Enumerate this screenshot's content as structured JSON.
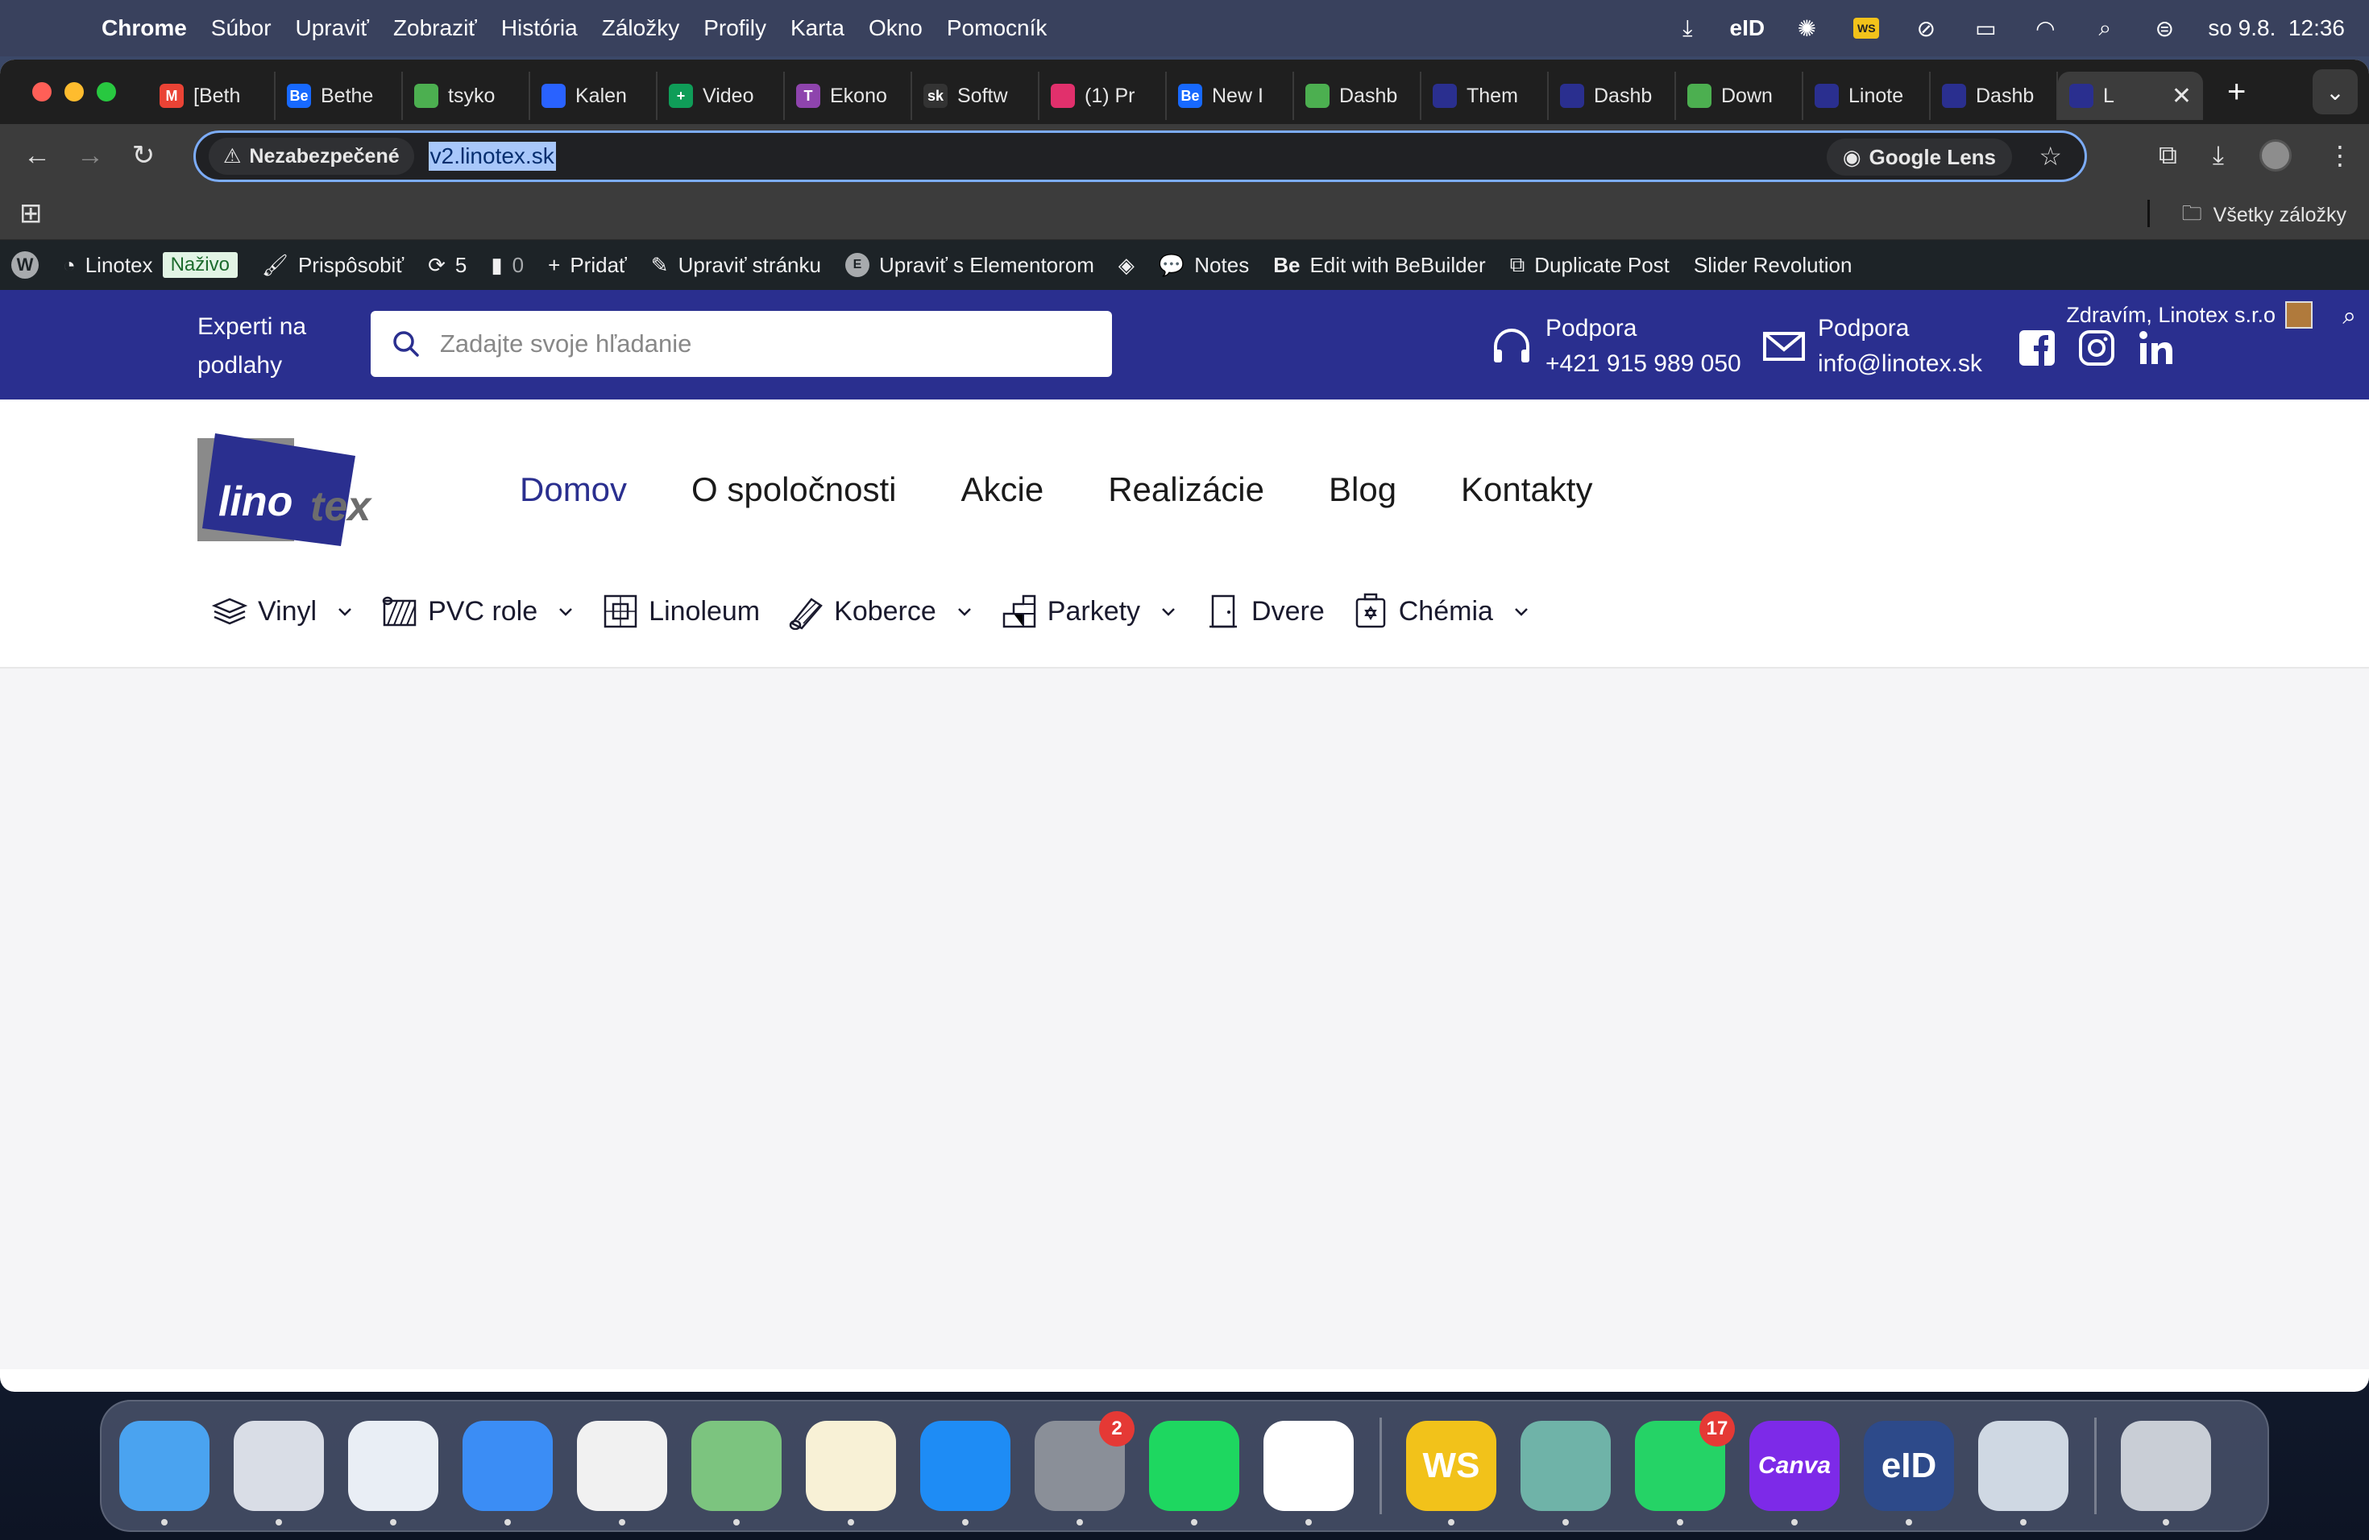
{
  "menubar": {
    "app_name": "Chrome",
    "items": [
      "Súbor",
      "Upraviť",
      "Zobraziť",
      "História",
      "Záložky",
      "Profily",
      "Karta",
      "Okno",
      "Pomocník"
    ],
    "eid_label": "eID",
    "ws_label": "WS",
    "clock": "so 9.8.  12:36"
  },
  "tabs": [
    {
      "icon": "gmail-icon",
      "fav": "M",
      "color": "#ea4335",
      "title": "[Beth"
    },
    {
      "icon": "behance-icon",
      "fav": "Be",
      "color": "#1769ff",
      "title": "Bethe"
    },
    {
      "icon": "green-app-icon",
      "fav": "",
      "color": "#4caf50",
      "title": "tsyko"
    },
    {
      "icon": "calendar-check-icon",
      "fav": "",
      "color": "#2962ff",
      "title": "Kalen"
    },
    {
      "icon": "sheets-icon",
      "fav": "+",
      "color": "#0f9d58",
      "title": "Video"
    },
    {
      "icon": "t-icon",
      "fav": "T",
      "color": "#8e44ad",
      "title": "Ekono"
    },
    {
      "icon": "sk-icon",
      "fav": "sk",
      "color": "#333333",
      "title": "Softw"
    },
    {
      "icon": "instagram-icon",
      "fav": "",
      "color": "#e1306c",
      "title": "(1) Pr"
    },
    {
      "icon": "behance-icon",
      "fav": "Be",
      "color": "#1769ff",
      "title": "New I"
    },
    {
      "icon": "green-app-icon",
      "fav": "",
      "color": "#4caf50",
      "title": "Dashb"
    },
    {
      "icon": "linotex-icon",
      "fav": "",
      "color": "#2a2f8f",
      "title": "Them"
    },
    {
      "icon": "linotex-icon",
      "fav": "",
      "color": "#2a2f8f",
      "title": "Dashb"
    },
    {
      "icon": "green-app-icon",
      "fav": "",
      "color": "#4caf50",
      "title": "Down"
    },
    {
      "icon": "linotex-icon",
      "fav": "",
      "color": "#2a2f8f",
      "title": "Linote"
    },
    {
      "icon": "linotex-icon",
      "fav": "",
      "color": "#2a2f8f",
      "title": "Dashb"
    }
  ],
  "active_tab": {
    "title": "L",
    "close": "✕"
  },
  "new_tab": "+",
  "address": {
    "security_label": "Nezabezpečené",
    "url": "v2.linotex.sk",
    "lens_label": "Google Lens"
  },
  "bookmarks": {
    "all_label": "Všetky záložky"
  },
  "wp_admin": {
    "site": "Linotex",
    "live_badge": "Naživo",
    "customize": "Prispôsobiť",
    "updates_count": "5",
    "comments_count": "0",
    "add": "Pridať",
    "edit_page": "Upraviť stránku",
    "elementor": "Upraviť s Elementorom",
    "notes": "Notes",
    "bebuilder": "Edit with BeBuilder",
    "duplicate": "Duplicate Post",
    "slider": "Slider Revolution"
  },
  "site": {
    "tagline": "Experti na podlahy",
    "search_placeholder": "Zadajte svoje hľadanie",
    "support_phone_label": "Podpora",
    "support_phone": "+421 915 989 050",
    "support_email_label": "Podpora",
    "support_email": "info@linotex.sk",
    "greeting": "Zdravím, Linotex s.r.o",
    "logo_left": "lino",
    "logo_right": "tex",
    "brand_color": "#2a2f8f",
    "menu": [
      {
        "label": "Domov",
        "active": true
      },
      {
        "label": "O spoločnosti",
        "active": false
      },
      {
        "label": "Akcie",
        "active": false
      },
      {
        "label": "Realizácie",
        "active": false
      },
      {
        "label": "Blog",
        "active": false
      },
      {
        "label": "Kontakty",
        "active": false
      }
    ],
    "categories": [
      {
        "label": "Vinyl",
        "icon": "vinyl-layers-icon",
        "dropdown": true
      },
      {
        "label": "PVC role",
        "icon": "pvc-roll-icon",
        "dropdown": true
      },
      {
        "label": "Linoleum",
        "icon": "linoleum-icon",
        "dropdown": false
      },
      {
        "label": "Koberce",
        "icon": "carpet-roll-icon",
        "dropdown": true
      },
      {
        "label": "Parkety",
        "icon": "parquet-icon",
        "dropdown": true
      },
      {
        "label": "Dvere",
        "icon": "door-icon",
        "dropdown": false
      },
      {
        "label": "Chémia",
        "icon": "chemistry-canister-icon",
        "dropdown": true
      }
    ]
  },
  "dock": {
    "apps": [
      {
        "name": "finder-icon",
        "label": "",
        "bg": "#4aa3f0"
      },
      {
        "name": "launchpad-icon",
        "label": "",
        "bg": "#d9dde6"
      },
      {
        "name": "safari-icon",
        "label": "",
        "bg": "#e9eef5"
      },
      {
        "name": "mail-icon",
        "label": "",
        "bg": "#3b8df5"
      },
      {
        "name": "chrome-icon",
        "label": "",
        "bg": "#f1f1f1"
      },
      {
        "name": "maps-icon",
        "label": "",
        "bg": "#7cc47f"
      },
      {
        "name": "notes-icon",
        "label": "",
        "bg": "#f8f1d6"
      },
      {
        "name": "app-store-icon",
        "label": "",
        "bg": "#1e8cf5"
      },
      {
        "name": "system-settings-icon",
        "label": "",
        "bg": "#8a8f98",
        "badge": "2"
      },
      {
        "name": "spotify-icon",
        "label": "",
        "bg": "#1ed760"
      },
      {
        "name": "chatgpt-icon",
        "label": "",
        "bg": "#ffffff"
      }
    ],
    "apps_right": [
      {
        "name": "ws-icon",
        "label": "WS",
        "bg": "#f2c21a"
      },
      {
        "name": "brush-app-icon",
        "label": "",
        "bg": "#6fb3a8"
      },
      {
        "name": "whatsapp-icon",
        "label": "",
        "bg": "#25d366",
        "badge": "17"
      },
      {
        "name": "canva-icon",
        "label": "Canva",
        "bg": "#7d2ae8"
      },
      {
        "name": "eid-app-icon",
        "label": "eID",
        "bg": "#2d4a8a"
      },
      {
        "name": "preview-icon",
        "label": "",
        "bg": "#cfd8e3"
      }
    ],
    "trash": {
      "name": "trash-icon",
      "label": "",
      "bg": "#c9ced6"
    }
  }
}
